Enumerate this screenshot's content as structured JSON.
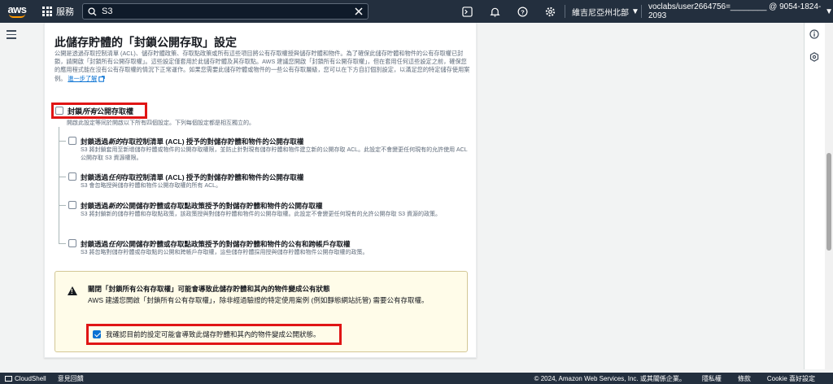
{
  "topnav": {
    "logo": "aws",
    "services_label": "服務",
    "search_value": "S3",
    "search_placeholder": "搜尋",
    "region": "維吉尼亞州北部",
    "account": "voclabs/user2664756=________ @ 9054-1824-2093",
    "icons": [
      "cloudshell-icon",
      "notifications-icon",
      "help-icon",
      "settings-icon"
    ]
  },
  "panel": {
    "title": "此儲存貯體的「封鎖公開存取」設定",
    "description": "公開是透過存取控制清單 (ACL)、儲存貯體政策、存取點政策或所有這些項目將公有存取權授與儲存貯體和物件。為了確保此儲存貯體和物件的公有存取權已封鎖，請開啟「封鎖所有公開存取權」。這些設定僅套用於此儲存貯體及其存取點。AWS 建議您開啟「封鎖所有公開存取權」，但在套用任何這些設定之前，確保您的應用程式能在沒有公有存取權的情況下正常運作。如果您需要此儲存貯體或物件的一些公有存取層級，您可以在下方自訂個別設定，以滿足您的特定儲存使用案例。",
    "learn_more": "進一步了解",
    "block_all": {
      "label_pre": "封鎖",
      "label_em": "所有",
      "label_post": "公開存取權",
      "sub": "開啟此設定等同於開啟以下所有四個設定。下列每個設定都是相互獨立的。",
      "checked": false
    },
    "options": [
      {
        "label_pre": "封鎖透過",
        "label_em": "新的",
        "label_post": "存取控制清單 (ACL) 授予的對儲存貯體和物件的公開存取權",
        "sub": "S3 將封鎖套用至新增儲存貯體或物件的公開存取權限，並防止針對現有儲存貯體和物件建立新的公開存取 ACL。此設定不會變更任何現有的允許使用 ACL 公開存取 S3 資源權限。",
        "checked": false
      },
      {
        "label_pre": "封鎖透過",
        "label_em": "任何",
        "label_post": "存取控制清單 (ACL) 授予的對儲存貯體和物件的公開存取權",
        "sub": "S3 會忽略授與儲存貯體和物件公開存取權的所有 ACL。",
        "checked": false
      },
      {
        "label_pre": "封鎖透過",
        "label_em": "新的",
        "label_post": "公開儲存貯體或存取點政策授予的對儲存貯體和物件的公開存取權",
        "sub": "S3 將封鎖新的儲存貯體和存取點政策，該政策授與對儲存貯體和物件的公開存取權。此設定不會變更任何現有的允許公開存取 S3 資源的政策。",
        "checked": false
      },
      {
        "label_pre": "封鎖透過",
        "label_em": "任何",
        "label_post": "公開儲存貯體或存取點政策授予的對儲存貯體和物件的公有和跨帳戶存取權",
        "sub": "S3 將忽略對儲存貯體或存取點的公開和跨帳戶存取權，這些儲存貯體採用授與儲存貯體和物件公開存取權的政策。",
        "checked": false
      }
    ],
    "warning": {
      "title": "關閉「封鎖所有公有存取權」可能會導致此儲存貯體和其內的物件變成公有狀態",
      "body": "AWS 建議您開啟「封鎖所有公有存取權」，除非經過驗證的特定使用案例 (例如靜態網站託管) 需要公有存取權。",
      "ack_label": "我確認目前的設定可能會導致此儲存貯體和其內的物件變成公開狀態。",
      "ack_checked": true
    }
  },
  "footer": {
    "cloudshell": "CloudShell",
    "feedback": "意見回饋",
    "copyright": "© 2024, Amazon Web Services, Inc. 或其關係企業。",
    "privacy": "隱私權",
    "terms": "條款",
    "cookie": "Cookie 喜好設定"
  }
}
